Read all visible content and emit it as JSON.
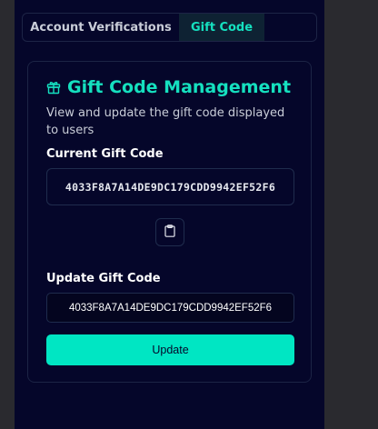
{
  "tabs": [
    {
      "label": "Account Verifications",
      "active": false
    },
    {
      "label": "Gift Code",
      "active": true
    }
  ],
  "card": {
    "icon": "gift-icon",
    "title": "Gift Code Management",
    "description": "View and update the gift code displayed to users",
    "current_label": "Current Gift Code",
    "current_code": "4033F8A7A14DE9DC179CDD9942EF52F6",
    "copy_icon": "clipboard-icon",
    "update_label": "Update Gift Code",
    "update_value": "4033F8A7A14DE9DC179CDD9942EF52F6",
    "update_button": "Update"
  },
  "colors": {
    "background": "#05062a",
    "accent": "#15e0bf",
    "button": "#00e6c3",
    "border": "#1f2c4d"
  }
}
